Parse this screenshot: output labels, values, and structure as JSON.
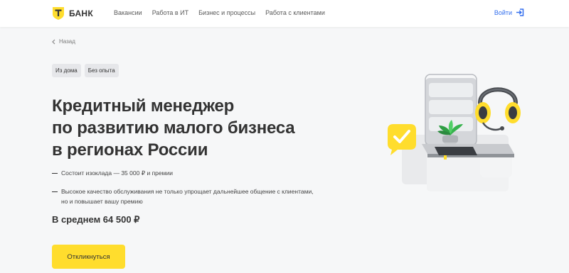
{
  "header": {
    "brand": "БАНК",
    "nav": [
      {
        "label": "Вакансии"
      },
      {
        "label": "Работа в ИТ"
      },
      {
        "label": "Бизнес и процессы"
      },
      {
        "label": "Работа с клиентами"
      }
    ],
    "login_label": "Войти",
    "logo_icon": "t-shield-icon",
    "login_icon": "sign-in-icon"
  },
  "back": {
    "label": "Назад",
    "icon": "chevron-left-icon"
  },
  "tags": [
    {
      "label": "Из дома"
    },
    {
      "label": "Без опыта"
    }
  ],
  "title": {
    "line1": "Кредитный менеджер",
    "line2": "по развитию малого бизнеса",
    "line3": "в регионах России"
  },
  "bullets": [
    {
      "text": "Состоит изоклада — 35 000 ₽ и премии"
    },
    {
      "line1": "Высокое качество обслуживания не только упрощает дальнейшее общение с клиентами,",
      "line2": "но и повышает вашу премию"
    }
  ],
  "salary": "В среднем 64 500 ₽",
  "apply_label": "Откликнуться",
  "colors": {
    "accent": "#ffdd2d",
    "link": "#336fee",
    "text": "#333333",
    "background": "#f6f7f8"
  }
}
